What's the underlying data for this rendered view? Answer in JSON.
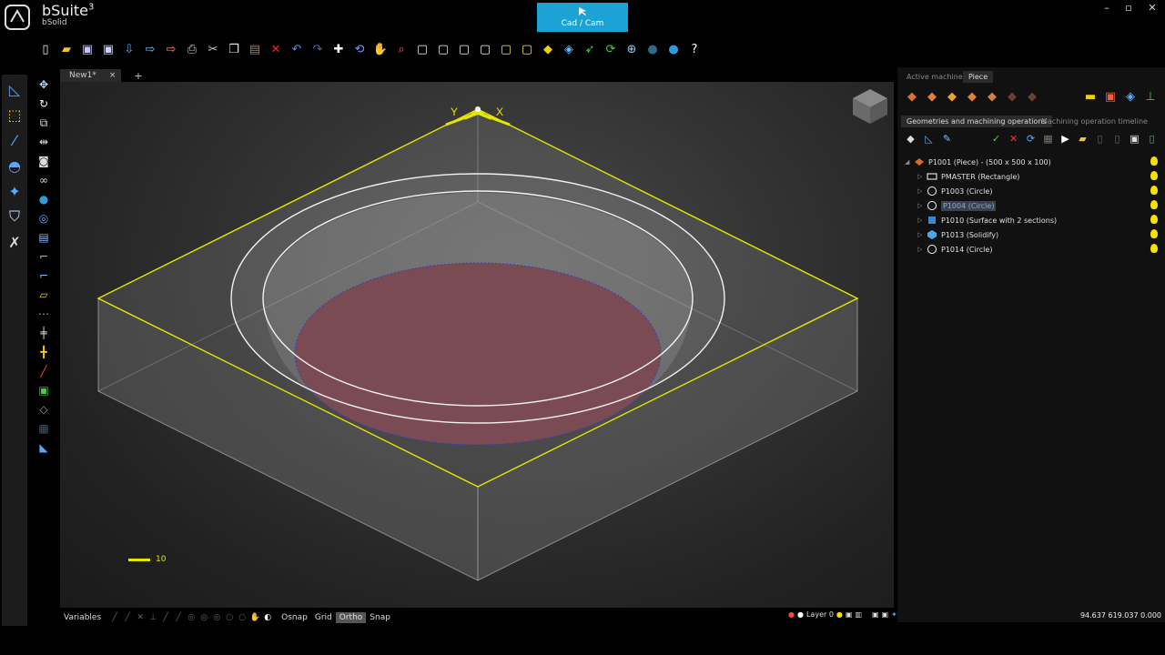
{
  "app": {
    "name": "bSuite",
    "version": "3",
    "company": "bSolid"
  },
  "mode_button": {
    "label": "Cad / Cam"
  },
  "window_controls": {
    "minimize": "–",
    "maximize": "▫",
    "close": "✕"
  },
  "toolbar": {
    "icons": [
      {
        "name": "new-file-icon",
        "glyph": "▯",
        "color": "#eeeeee"
      },
      {
        "name": "open-folder-icon",
        "glyph": "▰",
        "color": "#f0c040"
      },
      {
        "name": "save-icon",
        "glyph": "▣",
        "color": "#c0c8ff"
      },
      {
        "name": "save-as-icon",
        "glyph": "▣",
        "color": "#d0d0ff"
      },
      {
        "name": "import-icon",
        "glyph": "⇩",
        "color": "#66aaff"
      },
      {
        "name": "export-icon",
        "glyph": "⇨",
        "color": "#88bbff"
      },
      {
        "name": "export-pdf-icon",
        "glyph": "⇨",
        "color": "#ff8866"
      },
      {
        "name": "print-icon",
        "glyph": "⎙",
        "color": "#cccccc"
      },
      {
        "name": "cut-icon",
        "glyph": "✂",
        "color": "#cccccc"
      },
      {
        "name": "copy-icon",
        "glyph": "❐",
        "color": "#eeeeee"
      },
      {
        "name": "paste-icon",
        "glyph": "▤",
        "color": "#a08050"
      },
      {
        "name": "delete-icon",
        "glyph": "✕",
        "color": "#ee2222"
      },
      {
        "name": "undo-icon",
        "glyph": "↶",
        "color": "#5588ff"
      },
      {
        "name": "redo-icon",
        "glyph": "↷",
        "color": "#5566aa"
      },
      {
        "name": "select-icon",
        "glyph": "✚",
        "color": "#ffffff"
      },
      {
        "name": "rotate-view-icon",
        "glyph": "⟲",
        "color": "#7799ff"
      },
      {
        "name": "pan-icon",
        "glyph": "✋",
        "color": "#ffffff"
      },
      {
        "name": "zoom-window-icon",
        "glyph": "⌕",
        "color": "#ff5555"
      },
      {
        "name": "view-front-icon",
        "glyph": "▢",
        "color": "#f0f0f0"
      },
      {
        "name": "view-top-icon",
        "glyph": "▢",
        "color": "#f0f0f0"
      },
      {
        "name": "view-left-icon",
        "glyph": "▢",
        "color": "#f0f0f0"
      },
      {
        "name": "view-right-icon",
        "glyph": "▢",
        "color": "#f0f0f0"
      },
      {
        "name": "view-back-icon",
        "glyph": "▢",
        "color": "#f0e080"
      },
      {
        "name": "view-bottom-icon",
        "glyph": "▢",
        "color": "#f0e080"
      },
      {
        "name": "view-iso-icon",
        "glyph": "◆",
        "color": "#f0d000"
      },
      {
        "name": "view-3d-icon",
        "glyph": "◈",
        "color": "#66bbff"
      },
      {
        "name": "move-tool-icon",
        "glyph": "➶",
        "color": "#44dd44"
      },
      {
        "name": "refresh-icon",
        "glyph": "⟳",
        "color": "#44cc44"
      },
      {
        "name": "globe-wire-icon",
        "glyph": "⊕",
        "color": "#88ccff"
      },
      {
        "name": "shaded-sphere-icon",
        "glyph": "●",
        "color": "#2a6a8a"
      },
      {
        "name": "render-sphere-icon",
        "glyph": "●",
        "color": "#3399dd"
      },
      {
        "name": "help-icon",
        "glyph": "?",
        "color": "#ffffff"
      }
    ]
  },
  "left_primary": [
    {
      "name": "drawing-tools-icon",
      "glyph": "◺",
      "color": "#5599ff"
    },
    {
      "name": "edit-nodes-icon",
      "glyph": "⬚",
      "color": "#f0d000"
    },
    {
      "name": "measure-tool-icon",
      "glyph": "⁄",
      "color": "#66aaff"
    },
    {
      "name": "protractor-icon",
      "glyph": "◓",
      "color": "#55aaff"
    },
    {
      "name": "pin-tool-icon",
      "glyph": "✦",
      "color": "#55aaff"
    },
    {
      "name": "shield-icon",
      "glyph": "⛉",
      "color": "#bbddff"
    },
    {
      "name": "settings-tools-icon",
      "glyph": "✗",
      "color": "#dddddd"
    }
  ],
  "left_secondary": [
    {
      "name": "move-icon",
      "glyph": "✥",
      "color": "#bbddff"
    },
    {
      "name": "rotate-icon",
      "glyph": "↻",
      "color": "#ffffff"
    },
    {
      "name": "scale-icon",
      "glyph": "⧉",
      "color": "#dddddd"
    },
    {
      "name": "mirror-icon",
      "glyph": "⇹",
      "color": "#dddddd"
    },
    {
      "name": "offset-icon",
      "glyph": "◙",
      "color": "#dddddd"
    },
    {
      "name": "link-icon",
      "glyph": "∞",
      "color": "#dddddd"
    },
    {
      "name": "sphere-tool-icon",
      "glyph": "●",
      "color": "#3399dd"
    },
    {
      "name": "spiral-icon",
      "glyph": "◎",
      "color": "#55aaff"
    },
    {
      "name": "text-box-icon",
      "glyph": "▤",
      "color": "#88bbff"
    },
    {
      "name": "fillet-icon",
      "glyph": "⌐",
      "color": "#88bbff"
    },
    {
      "name": "chamfer-icon",
      "glyph": "⌐",
      "color": "#88bbff"
    },
    {
      "name": "contour-icon",
      "glyph": "▱",
      "color": "#f0d000"
    },
    {
      "name": "array-icon",
      "glyph": "⋯",
      "color": "#88bbff"
    },
    {
      "name": "align-icon",
      "glyph": "╪",
      "color": "#dddddd"
    },
    {
      "name": "split-icon",
      "glyph": "╋",
      "color": "#f0d000"
    },
    {
      "name": "line-cut-icon",
      "glyph": "╱",
      "color": "#ff4444"
    },
    {
      "name": "image-icon",
      "glyph": "▣",
      "color": "#44cc44"
    },
    {
      "name": "cube-wire-icon",
      "glyph": "◇",
      "color": "#8899bb"
    },
    {
      "name": "layers-dim-icon",
      "glyph": "▦",
      "color": "#445566"
    },
    {
      "name": "paint-bucket-icon",
      "glyph": "◣",
      "color": "#55aaff"
    }
  ],
  "document_tab": {
    "label": "New1*",
    "close": "×",
    "add": "+"
  },
  "viewport": {
    "axis_y": "Y",
    "axis_x": "X",
    "scale_label": "10"
  },
  "right_panel": {
    "tabs": [
      {
        "label": "Active machine",
        "active": false
      },
      {
        "label": "Piece",
        "active": true
      }
    ],
    "subtabs": [
      {
        "label": "Geometries and machining operations",
        "active": true
      },
      {
        "label": "Machining operation timeline",
        "active": false
      }
    ],
    "piece_icons": [
      {
        "name": "piece-icon",
        "glyph": "◆",
        "color": "#e07030"
      },
      {
        "name": "piece-add-icon",
        "glyph": "◆",
        "color": "#e08040"
      },
      {
        "name": "piece-move-icon",
        "glyph": "◆",
        "color": "#f0a030"
      },
      {
        "name": "piece-edit-icon",
        "glyph": "◆",
        "color": "#e08030"
      },
      {
        "name": "piece-copy-icon",
        "glyph": "◆",
        "color": "#d08040"
      },
      {
        "name": "piece-disabled-icon",
        "glyph": "◆",
        "color": "#6a4030"
      },
      {
        "name": "piece-disabled2-icon",
        "glyph": "◆",
        "color": "#6a4030"
      }
    ],
    "piece_icons_right": [
      {
        "name": "dimension-icon",
        "glyph": "▬",
        "color": "#f0d000"
      },
      {
        "name": "piece-image-icon",
        "glyph": "▣",
        "color": "#f06030"
      },
      {
        "name": "cube-view-icon",
        "glyph": "◈",
        "color": "#66aaff"
      },
      {
        "name": "axes-icon",
        "glyph": "⊥",
        "color": "#44cc44"
      }
    ],
    "ops_icons": [
      {
        "name": "layer-stack-icon",
        "glyph": "◆",
        "color": "#dddddd"
      },
      {
        "name": "add-geometry-icon",
        "glyph": "◺",
        "color": "#55aaff"
      },
      {
        "name": "pen-icon",
        "glyph": "✎",
        "color": "#88bbff"
      }
    ],
    "ops_icons_right": [
      {
        "name": "check-icon",
        "glyph": "✓",
        "color": "#44dd44"
      },
      {
        "name": "uncheck-icon",
        "glyph": "✕",
        "color": "#ee3333"
      },
      {
        "name": "sync-icon",
        "glyph": "⟳",
        "color": "#55aaff"
      },
      {
        "name": "grid-view-icon",
        "glyph": "▦",
        "color": "#777777"
      },
      {
        "name": "play-icon",
        "glyph": "▶",
        "color": "#ffffff"
      },
      {
        "name": "export-ops-icon",
        "glyph": "▰",
        "color": "#f0c040"
      },
      {
        "name": "doc-dim-icon",
        "glyph": "▯",
        "color": "#666666"
      },
      {
        "name": "doc-dim2-icon",
        "glyph": "▯",
        "color": "#666666"
      },
      {
        "name": "save-ops-icon",
        "glyph": "▣",
        "color": "#dddddd"
      },
      {
        "name": "doc-green-icon",
        "glyph": "▯",
        "color": "#44cc44"
      }
    ],
    "tree": [
      {
        "label": "P1001 (Piece) - (500 x 500 x 100)",
        "level": 0,
        "icon": "piece-icon",
        "expanded": true
      },
      {
        "label": "PMASTER (Rectangle)",
        "level": 1,
        "icon": "rectangle-icon"
      },
      {
        "label": "P1003 (Circle)",
        "level": 1,
        "icon": "circle-icon"
      },
      {
        "label": "P1004 (Circle)",
        "level": 1,
        "icon": "circle-icon",
        "selected": true
      },
      {
        "label": "P1010 (Surface with 2 sections)",
        "level": 1,
        "icon": "surface-icon"
      },
      {
        "label": "P1013 (Solidify)",
        "level": 1,
        "icon": "solidify-icon"
      },
      {
        "label": "P1014 (Circle)",
        "level": 1,
        "icon": "circle-icon"
      }
    ]
  },
  "statusbar": {
    "variables": "Variables",
    "osnap": "Osnap",
    "grid": "Grid",
    "ortho": "Ortho",
    "snap": "Snap",
    "layer": "Layer 0",
    "coords": "94.637  619.037  0.000"
  }
}
